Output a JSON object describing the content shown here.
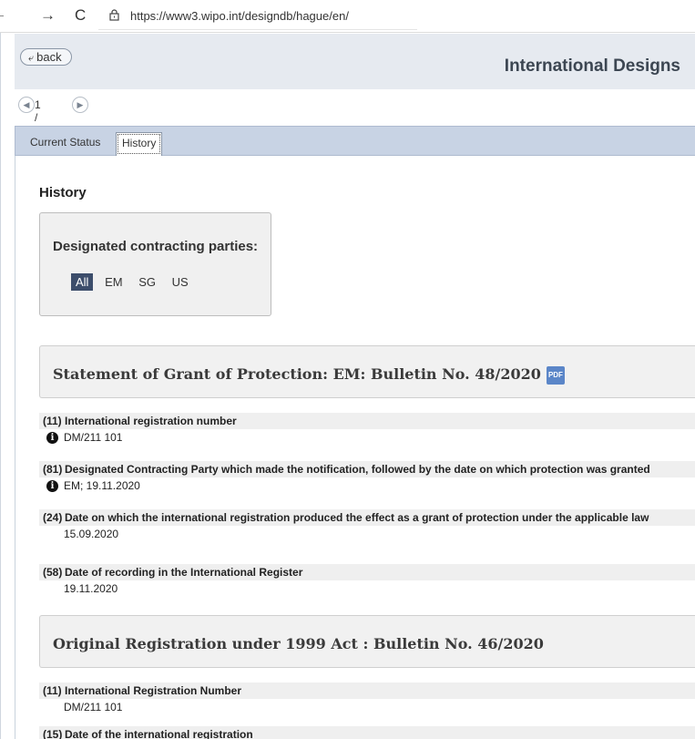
{
  "browser": {
    "back": "←",
    "forward": "→",
    "reload": "C",
    "url": "https://www3.wipo.int/designdb/hague/en/"
  },
  "header": {
    "back_label": "back",
    "title": "International Designs"
  },
  "pager": {
    "text": "1 / 1"
  },
  "tabs": [
    {
      "label": "Current Status"
    },
    {
      "label": "History"
    }
  ],
  "history": {
    "title": "History",
    "dcp_title": "Designated contracting parties:",
    "filters": [
      "All",
      "EM",
      "SG",
      "US"
    ],
    "active_filter": "All"
  },
  "sections": [
    {
      "title": "Statement of Grant of Protection: EM: Bulletin No. 48/2020",
      "pdf_label": "PDF",
      "fields": [
        {
          "code": "(11)",
          "label": "International registration number",
          "value": "DM/211 101",
          "info": true
        },
        {
          "code": "(81)",
          "label": "Designated Contracting Party which made the notification, followed by the date on which protection was granted",
          "value": "EM; 19.11.2020",
          "info": true
        },
        {
          "code": "(24)",
          "label": "Date on which the international registration produced the effect as a grant of protection under the applicable law",
          "value": "15.09.2020",
          "info": false
        },
        {
          "code": "(58)",
          "label": "Date of recording in the International Register",
          "value": "19.11.2020",
          "info": false
        }
      ]
    },
    {
      "title": "Original Registration under 1999 Act : Bulletin No. 46/2020",
      "fields": [
        {
          "code": "(11)",
          "label": "International Registration Number",
          "value": "DM/211 101",
          "info": false
        },
        {
          "code": "(15)",
          "label": "Date of the international registration",
          "value": "",
          "info": false
        }
      ]
    }
  ]
}
